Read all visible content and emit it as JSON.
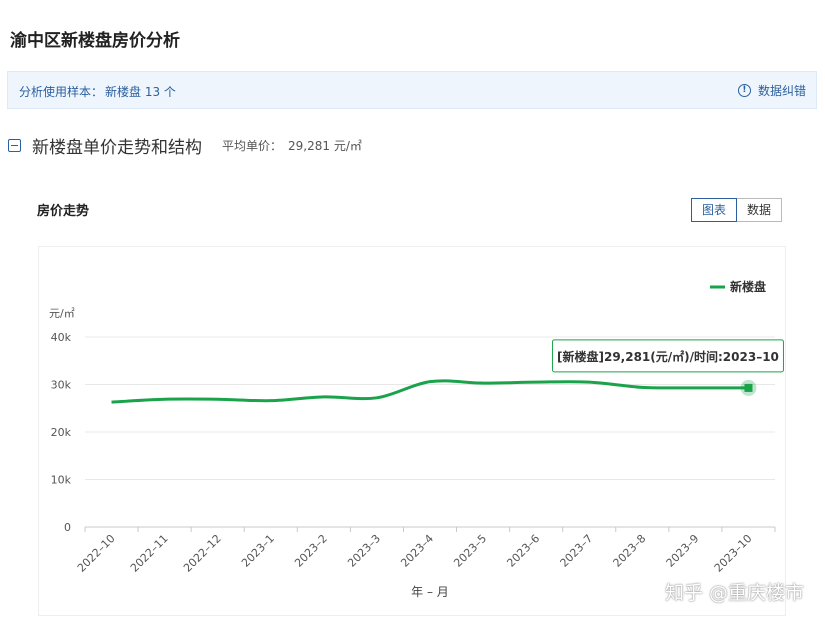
{
  "page": {
    "title": "渝中区新楼盘房价分析"
  },
  "sample_bar": {
    "label": "分析使用样本：",
    "value": "新楼盘 13 个",
    "fix_label": "数据纠错",
    "fix_icon": "info-icon"
  },
  "section": {
    "title": "新楼盘单价走势和结构",
    "avg_label": "平均单价：",
    "avg_value": "29,281 元/㎡"
  },
  "chart_panel": {
    "heading": "房价走势",
    "tabs": [
      {
        "label": "图表",
        "active": true
      },
      {
        "label": "数据",
        "active": false
      }
    ]
  },
  "chart_data": {
    "type": "line",
    "ylabel": "元/㎡",
    "xlabel": "年 – 月",
    "ylim": [
      0,
      40000
    ],
    "ytick_values": [
      0,
      10000,
      20000,
      30000,
      40000
    ],
    "ytick_labels": [
      "0",
      "10k",
      "20k",
      "30k",
      "40k"
    ],
    "categories": [
      "2022–10",
      "2022–11",
      "2022–12",
      "2023–1",
      "2023–2",
      "2023–3",
      "2023–4",
      "2023–5",
      "2023–6",
      "2023–7",
      "2023–8",
      "2023–9",
      "2023–10"
    ],
    "series": [
      {
        "name": "新楼盘",
        "color": "#1aa34a",
        "values": [
          26300,
          26900,
          26900,
          26600,
          27400,
          27200,
          30600,
          30300,
          30500,
          30500,
          29400,
          29300,
          29281
        ]
      }
    ],
    "legend_position": "top-right",
    "grid": true,
    "tooltip": {
      "text": "[新楼盘]29,281(元/㎡)/时间:2023–10",
      "index": 12
    }
  },
  "watermark": {
    "text": "知乎 @重庆楼市"
  }
}
